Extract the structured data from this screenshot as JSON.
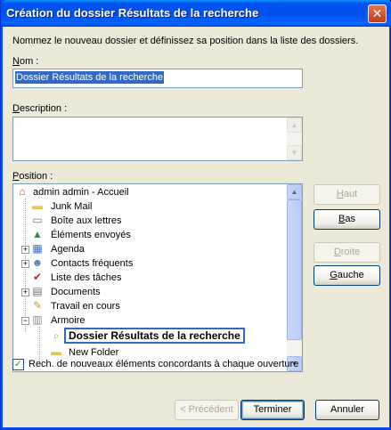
{
  "window": {
    "title": "Création du dossier Résultats de la recherche",
    "close_glyph": "✕"
  },
  "intro": "Nommez le nouveau dossier et définissez sa position dans la liste des dossiers.",
  "name_field": {
    "label_access": "N",
    "label_rest": "om :",
    "value": "Dossier Résultats de la recherche"
  },
  "description_field": {
    "label_access": "D",
    "label_rest": "escription :",
    "value": ""
  },
  "position": {
    "label_access": "P",
    "label_rest": "osition :",
    "tree": [
      {
        "label": "admin admin - Accueil",
        "icon": "home-icon",
        "glyph": "⌂",
        "color": "#c04020"
      },
      {
        "label": "Junk Mail",
        "icon": "folder-icon",
        "glyph": "▬",
        "color": "#e8c552"
      },
      {
        "label": "Boîte aux lettres",
        "icon": "mailbox-icon",
        "glyph": "▭",
        "color": "#6a7a90"
      },
      {
        "label": "Éléments envoyés",
        "icon": "sent-items-icon",
        "glyph": "▲",
        "color": "#3b8a3b"
      },
      {
        "label": "Agenda",
        "icon": "calendar-icon",
        "glyph": "▦",
        "color": "#3d6fc2"
      },
      {
        "label": "Contacts fréquents",
        "icon": "contacts-icon",
        "glyph": "☻",
        "color": "#5a7fc6"
      },
      {
        "label": "Liste des tâches",
        "icon": "checklist-icon",
        "glyph": "✔",
        "color": "#d02020"
      },
      {
        "label": "Documents",
        "icon": "documents-icon",
        "glyph": "▤",
        "color": "#6f6f6f"
      },
      {
        "label": "Travail en cours",
        "icon": "work-in-progress-icon",
        "glyph": "✎",
        "color": "#c29a2b"
      },
      {
        "label": "Armoire",
        "icon": "cabinet-icon",
        "glyph": "▥",
        "color": "#8a8a8a"
      },
      {
        "label": "Dossier Résultats de la recherche",
        "icon": "search-folder-icon",
        "glyph": "⌕",
        "color": "#c29a2b"
      },
      {
        "label": "New Folder",
        "icon": "folder-icon",
        "glyph": "▬",
        "color": "#e8c552"
      }
    ]
  },
  "buttons": {
    "haut_access": "H",
    "haut_rest": "aut",
    "bas_access": "B",
    "bas_rest": "as",
    "droite_access": "D",
    "droite_rest": "roite",
    "gauche_access": "G",
    "gauche_rest": "auche",
    "previous": "< Précédent",
    "finish": "Terminer",
    "cancel": "Annuler"
  },
  "checkbox": {
    "checked": true,
    "label": "Rech. de nouveaux éléments concordants à chaque ouverture"
  },
  "colors": {
    "titlebar": "#0053ee",
    "selection": "#316ac5",
    "dialog_bg": "#ece9d8"
  }
}
